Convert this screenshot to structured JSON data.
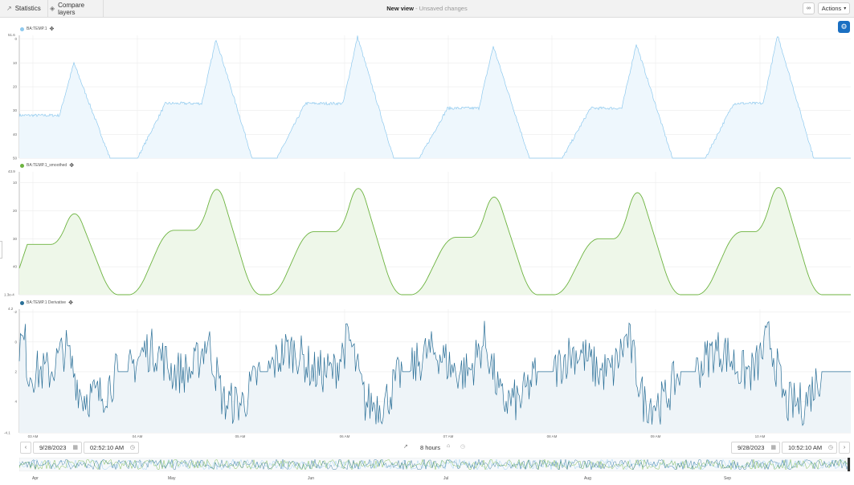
{
  "topbar": {
    "statistics_label": "Statistics",
    "compare_layers_label": "Compare layers",
    "view_title": "New view",
    "unsaved_text": " - Unsaved changes",
    "actions_label": "Actions"
  },
  "charts": {
    "x_ticks": [
      "03 AM",
      "04 AM",
      "05 AM",
      "06 AM",
      "07 AM",
      "08 AM",
      "09 AM",
      "10 AM"
    ],
    "panels": [
      {
        "series_name": "BA:TEMP.1",
        "color": "#8ec9ee",
        "fill": "#eef7fd",
        "y_top_label": "51.6",
        "y_ticks": [
          "50",
          "40",
          "30",
          "20",
          "10",
          "0"
        ],
        "y_bottom_label": ""
      },
      {
        "series_name": "BA:TEMP.1_smoothed",
        "color": "#6cb33f",
        "fill": "#eef7e9",
        "y_top_label": "43.9",
        "y_ticks": [
          "40",
          "30",
          "20",
          "10"
        ],
        "y_bottom_label": "1.3e-4"
      },
      {
        "series_name": "BA:TEMP.1 Derivative",
        "color": "#2a6f97",
        "fill": "#eef4f8",
        "y_top_label": "4.2",
        "y_ticks": [
          "4",
          "2",
          "0",
          "-2"
        ],
        "y_bottom_label": "-4.1"
      }
    ]
  },
  "range": {
    "start_date": "9/28/2023",
    "start_time": "02:52:10 AM",
    "period": "8 hours",
    "end_date": "9/28/2023",
    "end_time": "10:52:10 AM"
  },
  "overview": {
    "month_labels": [
      "Apr",
      "May",
      "Jun",
      "Jul",
      "Aug",
      "Sep"
    ]
  },
  "chart_data": [
    {
      "type": "area",
      "series": [
        {
          "name": "BA:TEMP.1"
        }
      ],
      "y_ticks": [
        0,
        10,
        20,
        30,
        40,
        50
      ],
      "ylim": [
        0,
        51.6
      ],
      "x_ticks": [
        "03 AM",
        "04 AM",
        "05 AM",
        "06 AM",
        "07 AM",
        "08 AM",
        "09 AM",
        "10 AM"
      ],
      "cycles": [
        {
          "plateau": 18,
          "peak": 40
        },
        {
          "plateau": 23,
          "peak": 50
        },
        {
          "plateau": 23,
          "peak": 51
        },
        {
          "plateau": 21,
          "peak": 47
        },
        {
          "plateau": 21,
          "peak": 48
        },
        {
          "plateau": 23,
          "peak": 51.6
        }
      ]
    },
    {
      "type": "area",
      "series": [
        {
          "name": "BA:TEMP.1_smoothed"
        }
      ],
      "y_ticks": [
        10,
        20,
        30,
        40
      ],
      "ylim": [
        0.00013,
        43.9
      ],
      "cycles": [
        {
          "plateau": 18,
          "peak": 33
        },
        {
          "plateau": 23,
          "peak": 43
        },
        {
          "plateau": 22.5,
          "peak": 43.5
        },
        {
          "plateau": 20.5,
          "peak": 40
        },
        {
          "plateau": 20,
          "peak": 42
        },
        {
          "plateau": 22.5,
          "peak": 43.9
        }
      ]
    },
    {
      "type": "line",
      "series": [
        {
          "name": "BA:TEMP.1 Derivative"
        }
      ],
      "y_ticks": [
        -2,
        0,
        2,
        4
      ],
      "ylim": [
        -4.1,
        4.2
      ]
    }
  ]
}
